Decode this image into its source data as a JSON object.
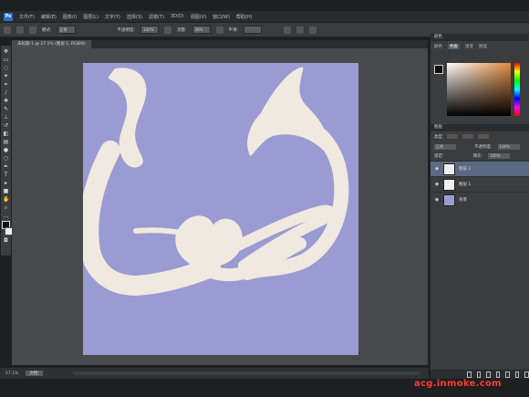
{
  "menu": {
    "logo": "Ps",
    "items": [
      "文件(F)",
      "编辑(E)",
      "图像(I)",
      "图层(L)",
      "文字(Y)",
      "选择(S)",
      "滤镜(T)",
      "3D(D)",
      "视图(V)",
      "窗口(W)",
      "帮助(H)"
    ]
  },
  "options": {
    "mode_label": "模式:",
    "mode_value": "正常",
    "opacity_label": "不透明度:",
    "opacity_value": "100%",
    "flow_label": "流量:",
    "flow_value": "30%",
    "smooth_label": "平滑:"
  },
  "document": {
    "tab_title": "未标题-1 @ 27.1% (图层 1, RGB/8)",
    "canvas_color": "#9a9bd2",
    "stroke_color": "#efe9e0"
  },
  "status": {
    "zoom": "27.1%",
    "doc_info": "文档:"
  },
  "color_panel": {
    "title": "颜色",
    "tabs": [
      "颜色",
      "色板",
      "渐变",
      "图案"
    ],
    "active_tab": "色板"
  },
  "layers_panel": {
    "title": "图层",
    "kind_label": "类型",
    "blend_mode": "正常",
    "opacity_label": "不透明度:",
    "opacity_value": "100%",
    "lock_label": "锁定:",
    "fill_label": "填充:",
    "fill_value": "100%",
    "layers": [
      {
        "name": "图层 2",
        "thumb": "white",
        "active": true
      },
      {
        "name": "图层 1",
        "thumb": "white",
        "active": false
      },
      {
        "name": "背景",
        "thumb": "purple",
        "active": false
      }
    ]
  },
  "watermark": "acg.inmoke.com"
}
